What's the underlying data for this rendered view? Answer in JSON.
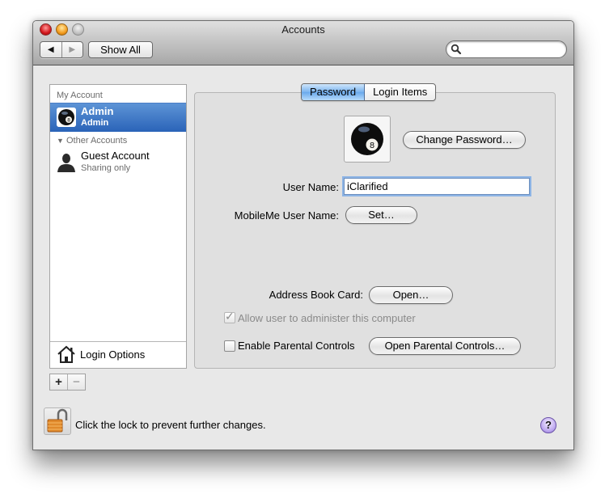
{
  "window": {
    "title": "Accounts",
    "show_all_label": "Show All",
    "search": {
      "placeholder": "",
      "value": ""
    },
    "nav": {
      "back_icon": "◀",
      "forward_icon": "▶"
    }
  },
  "sidebar": {
    "my_account_header": "My Account",
    "other_accounts_header": "Other Accounts",
    "disclosure_icon": "▼",
    "accounts": [
      {
        "name": "Admin",
        "role": "Admin",
        "icon": "eight-ball-icon",
        "selected": true
      },
      {
        "name": "Guest Account",
        "role": "Sharing only",
        "icon": "person-silhouette-icon",
        "selected": false
      }
    ],
    "login_options_label": "Login Options",
    "add_label": "+",
    "remove_label": "−"
  },
  "panel": {
    "tabs": [
      {
        "label": "Password",
        "active": true
      },
      {
        "label": "Login Items",
        "active": false
      }
    ],
    "change_password_label": "Change Password…",
    "user_name_label": "User Name:",
    "user_name_value": "iClarified",
    "mobileme_label": "MobileMe User Name:",
    "set_label": "Set…",
    "address_book_label": "Address Book Card:",
    "open_label": "Open…",
    "allow_admin_label": "Allow user to administer this computer",
    "allow_admin_checked": true,
    "allow_admin_enabled": false,
    "parental_label": "Enable Parental Controls",
    "parental_checked": false,
    "open_parental_label": "Open Parental Controls…"
  },
  "footer": {
    "lock_text": "Click the lock to prevent further changes.",
    "lock_state": "unlocked",
    "help_label": "?"
  },
  "colors": {
    "selection": "#2a63b8",
    "tab_active": "#79b3ef",
    "focus_ring": "#8db4e5",
    "help": "#b8a2ee"
  }
}
